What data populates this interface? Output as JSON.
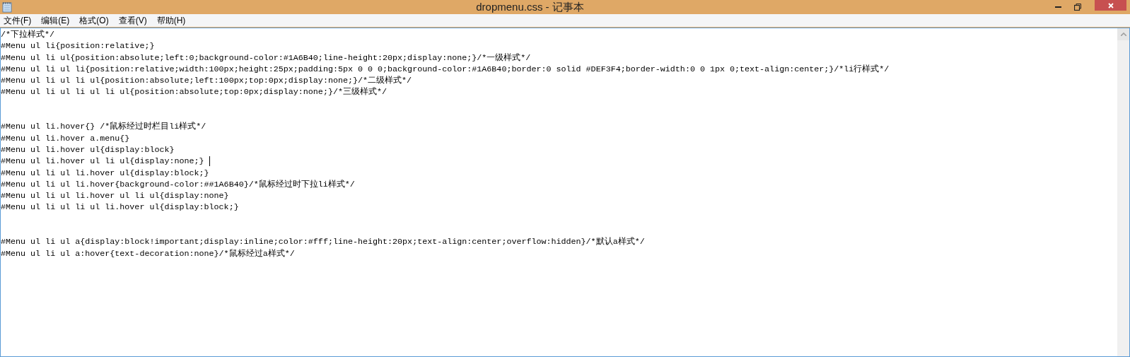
{
  "window": {
    "title": "dropmenu.css - 记事本"
  },
  "menu": [
    "文件(F)",
    "编辑(E)",
    "格式(O)",
    "查看(V)",
    "帮助(H)"
  ],
  "editor": {
    "lines": [
      {
        "kind": "code",
        "text": "/*下拉样式*/",
        "caret": false
      },
      {
        "kind": "code",
        "text": "#Menu ul li{position:relative;}",
        "caret": false
      },
      {
        "kind": "code",
        "text": "#Menu ul li ul{position:absolute;left:0;background-color:#1A6B40;line-height:20px;display:none;}/*一级样式*/",
        "caret": false
      },
      {
        "kind": "code",
        "text": "#Menu ul li ul li{position:relative;width:100px;height:25px;padding:5px 0 0 0;background-color:#1A6B40;border:0 solid #DEF3F4;border-width:0 0 1px 0;text-align:center;}/*li行样式*/",
        "caret": false
      },
      {
        "kind": "code",
        "text": "#Menu ul li ul li ul{position:absolute;left:100px;top:0px;display:none;}/*二级样式*/",
        "caret": false
      },
      {
        "kind": "code",
        "text": "#Menu ul li ul li ul li ul{position:absolute;top:0px;display:none;}/*三级样式*/",
        "caret": false
      },
      {
        "kind": "blank"
      },
      {
        "kind": "blank"
      },
      {
        "kind": "code",
        "text": "#Menu ul li.hover{} /*鼠标经过时栏目li样式*/",
        "caret": false
      },
      {
        "kind": "code",
        "text": "#Menu ul li.hover a.menu{}",
        "caret": false
      },
      {
        "kind": "code",
        "text": "#Menu ul li.hover ul{display:block}",
        "caret": false
      },
      {
        "kind": "code",
        "text": "#Menu ul li.hover ul li ul{display:none;}",
        "caret": true
      },
      {
        "kind": "code",
        "text": "#Menu ul li ul li.hover ul{display:block;}",
        "caret": false
      },
      {
        "kind": "code",
        "text": "#Menu ul li ul li.hover{background-color:##1A6B40}/*鼠标经过时下拉li样式*/",
        "caret": false
      },
      {
        "kind": "code",
        "text": "#Menu ul li ul li.hover ul li ul{display:none}",
        "caret": false
      },
      {
        "kind": "code",
        "text": "#Menu ul li ul li ul li.hover ul{display:block;}",
        "caret": false
      },
      {
        "kind": "blank"
      },
      {
        "kind": "blank"
      },
      {
        "kind": "code",
        "text": "#Menu ul li ul a{display:block!important;display:inline;color:#fff;line-height:20px;text-align:center;overflow:hidden}/*默认a样式*/",
        "caret": false
      },
      {
        "kind": "code",
        "text": "#Menu ul li ul a:hover{text-decoration:none}/*鼠标经过a样式*/",
        "caret": false
      }
    ]
  }
}
